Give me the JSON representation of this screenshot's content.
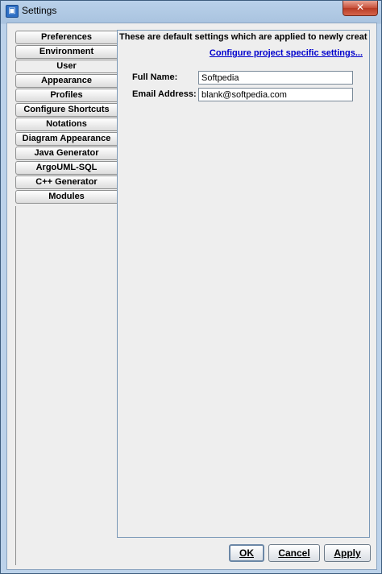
{
  "window": {
    "title": "Settings",
    "close_label": "✕"
  },
  "tabs": [
    {
      "label": "Preferences"
    },
    {
      "label": "Environment"
    },
    {
      "label": "User",
      "selected": true
    },
    {
      "label": "Appearance"
    },
    {
      "label": "Profiles"
    },
    {
      "label": "Configure Shortcuts"
    },
    {
      "label": "Notations"
    },
    {
      "label": "Diagram Appearance"
    },
    {
      "label": "Java Generator"
    },
    {
      "label": "ArgoUML-SQL"
    },
    {
      "label": "C++ Generator"
    },
    {
      "label": "Modules"
    }
  ],
  "panel": {
    "info_text": "These are default settings which are applied to newly create...",
    "config_link": "Configure project specific settings...",
    "full_name_label": "Full Name:",
    "full_name_value": "Softpedia",
    "email_label": "Email Address:",
    "email_value": "blank@softpedia.com"
  },
  "buttons": {
    "ok": "OK",
    "cancel": "Cancel",
    "apply": "Apply"
  },
  "colors": {
    "title_bar": "#a9c3df",
    "link": "#0000cc",
    "close": "#c7503a"
  }
}
